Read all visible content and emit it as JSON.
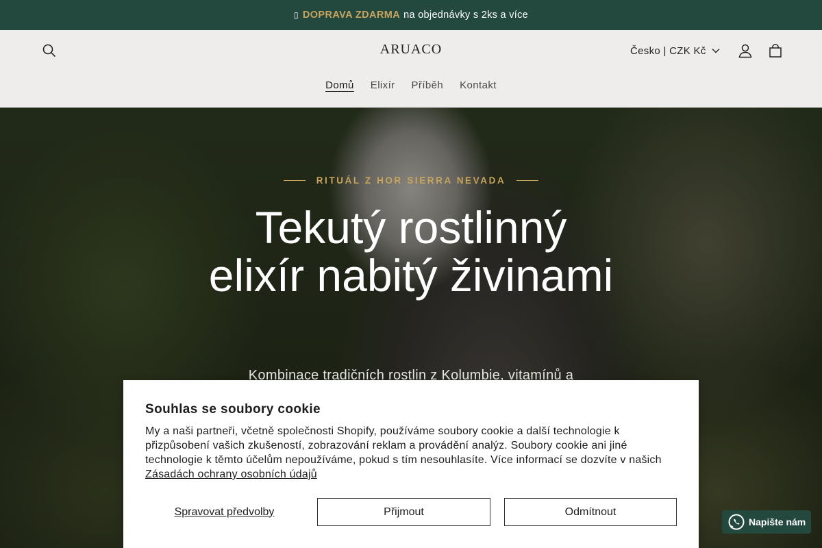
{
  "announcement": {
    "glyph": "▯",
    "highlight": "DOPRAVA ZDARMA",
    "text": "na objednávky s 2ks a více"
  },
  "header": {
    "logo": "ARUACO",
    "locale": "Česko | CZK Kč",
    "nav": [
      {
        "label": "Domů",
        "active": true
      },
      {
        "label": "Elixír",
        "active": false
      },
      {
        "label": "Příběh",
        "active": false
      },
      {
        "label": "Kontakt",
        "active": false
      }
    ],
    "icons": [
      "search-icon",
      "account-icon",
      "cart-icon"
    ]
  },
  "hero": {
    "eyebrow": "RITUÁL Z HOR SIERRA NEVADA",
    "title": "Tekutý rostlinný elixír nabitý živinami",
    "subtitle": "Kombinace tradičních rostlin z Kolumbie, vitamínů a"
  },
  "cookie_banner": {
    "title": "Souhlas se soubory cookie",
    "text": "My a naši partneři, včetně společnosti Shopify, používáme soubory cookie a další technologie k přizpůsobení vašich zkušeností, zobrazování reklam a provádění analýz. Soubory cookie ani jiné technologie k těmto účelům nepoužíváme, pokud s tím nesouhlasíte. Více informací se dozvíte v našich",
    "link": "Zásadách ochrany osobních údajů",
    "manage_label": "Spravovat předvolby",
    "accept_label": "Přijmout",
    "decline_label": "Odmítnout"
  },
  "chat": {
    "label": "Napište nám",
    "icon": "whatsapp-icon"
  },
  "colors": {
    "announcement_bg": "#23483e",
    "accent_gold": "#c9a45c",
    "header_bg": "#eeedeb"
  }
}
